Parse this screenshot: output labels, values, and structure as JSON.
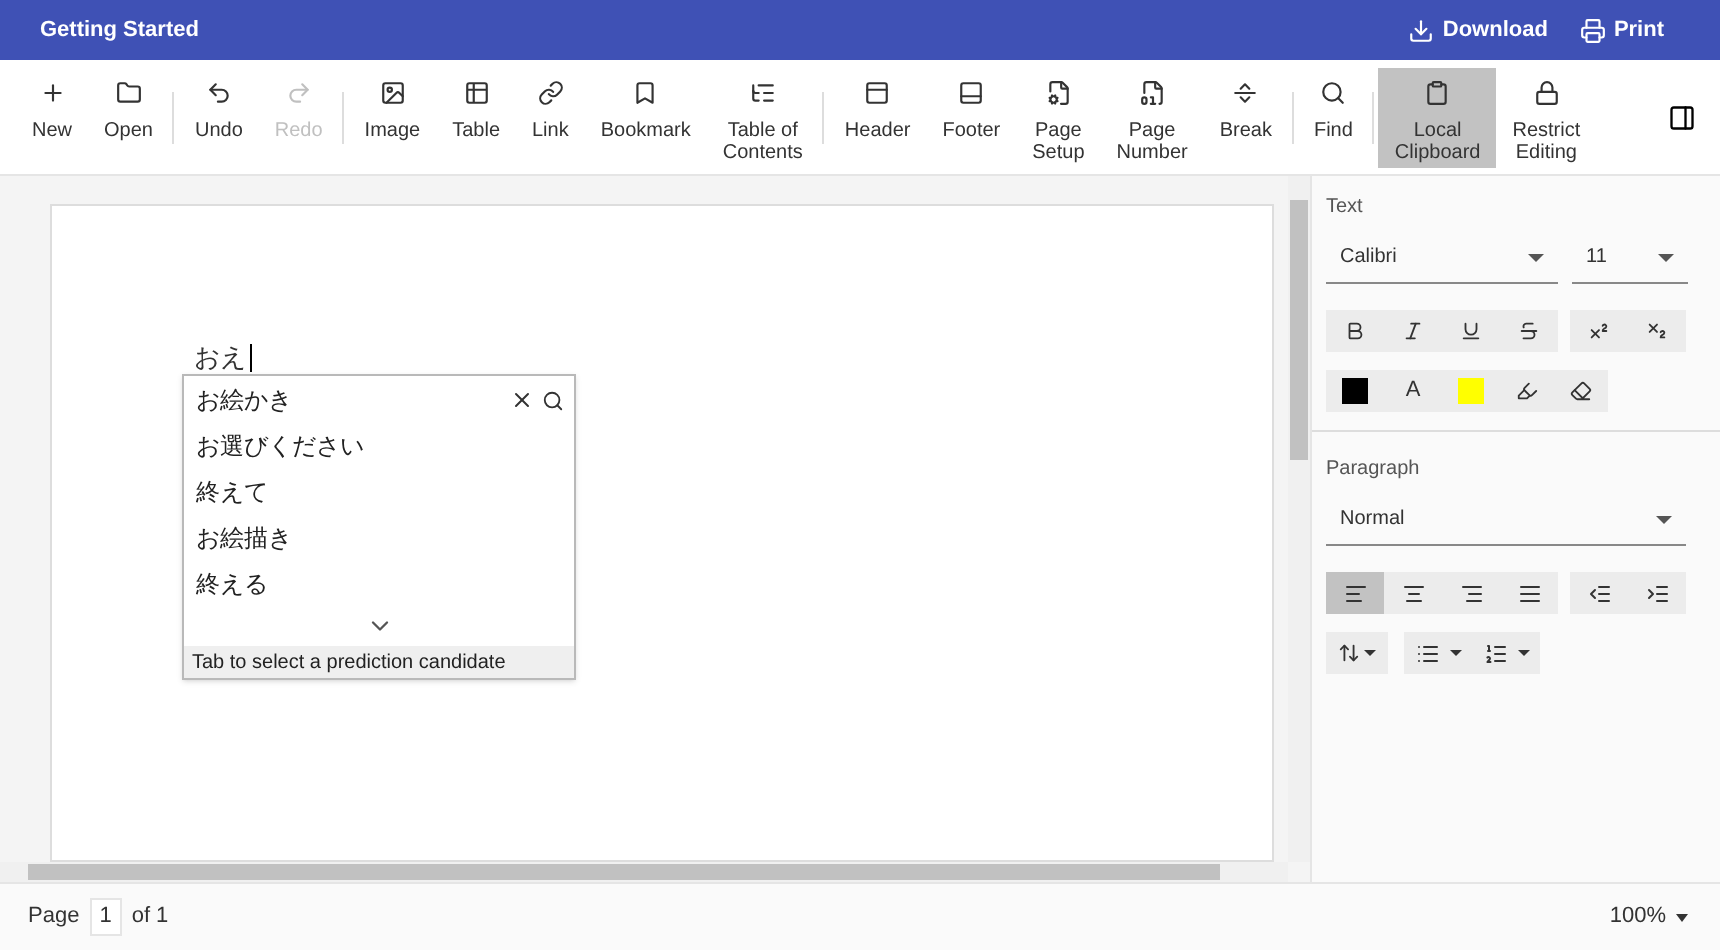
{
  "title_bar": {
    "title": "Getting Started",
    "actions": [
      {
        "label": "Download",
        "kind": "download"
      },
      {
        "label": "Print",
        "kind": "print"
      }
    ]
  },
  "toolbar": {
    "groups": [
      [
        {
          "label": "New",
          "kind": "plus",
          "disabled": false,
          "selected": false
        },
        {
          "label": "Open",
          "kind": "folder",
          "disabled": false,
          "selected": false
        }
      ],
      [
        {
          "label": "Undo",
          "kind": "undo",
          "disabled": false,
          "selected": false
        },
        {
          "label": "Redo",
          "kind": "redo",
          "disabled": true,
          "selected": false
        }
      ],
      [
        {
          "label": "Image",
          "kind": "image",
          "disabled": false,
          "selected": false
        },
        {
          "label": "Table",
          "kind": "table",
          "disabled": false,
          "selected": false
        },
        {
          "label": "Link",
          "kind": "link",
          "disabled": false,
          "selected": false
        },
        {
          "label": "Bookmark",
          "kind": "bookmark",
          "disabled": false,
          "selected": false
        },
        {
          "label": "Table of\nContents",
          "kind": "toc",
          "disabled": false,
          "selected": false
        }
      ],
      [
        {
          "label": "Header",
          "kind": "header",
          "disabled": false,
          "selected": false
        },
        {
          "label": "Footer",
          "kind": "footer",
          "disabled": false,
          "selected": false
        },
        {
          "label": "Page\nSetup",
          "kind": "pagesetup",
          "disabled": false,
          "selected": false
        },
        {
          "label": "Page\nNumber",
          "kind": "pagenumber",
          "disabled": false,
          "selected": false
        },
        {
          "label": "Break",
          "kind": "break",
          "disabled": false,
          "selected": false
        }
      ],
      [
        {
          "label": "Find",
          "kind": "search",
          "disabled": false,
          "selected": false
        }
      ],
      [
        {
          "label": "Local\nClipboard",
          "kind": "clipboard",
          "disabled": false,
          "selected": true
        },
        {
          "label": "Restrict\nEditing",
          "kind": "lock",
          "disabled": false,
          "selected": false
        }
      ]
    ]
  },
  "document": {
    "typed_text": "おえ",
    "prediction": {
      "candidates": [
        "お絵かき",
        "お選びください",
        "終えて",
        "お絵描き",
        "終える"
      ],
      "hint": "Tab to select a prediction candidate"
    }
  },
  "properties": {
    "text": {
      "heading": "Text",
      "font": "Calibri",
      "size": "11",
      "format_buttons": [
        {
          "kind": "bold"
        },
        {
          "kind": "italic"
        },
        {
          "kind": "underline"
        },
        {
          "kind": "strike"
        }
      ],
      "script_buttons": [
        {
          "kind": "superscript"
        },
        {
          "kind": "subscript"
        }
      ],
      "color_buttons": [
        {
          "kind": "swatch",
          "color": "#000000"
        },
        {
          "kind": "letter",
          "label": "A"
        },
        {
          "kind": "swatch",
          "color": "#ffff00"
        },
        {
          "kind": "highlighter"
        },
        {
          "kind": "eraser"
        }
      ]
    },
    "paragraph": {
      "heading": "Paragraph",
      "style": "Normal",
      "alignment": [
        {
          "kind": "left",
          "selected": true
        },
        {
          "kind": "center",
          "selected": false
        },
        {
          "kind": "right",
          "selected": false
        },
        {
          "kind": "justify",
          "selected": false
        }
      ],
      "indent": [
        {
          "kind": "outdent"
        },
        {
          "kind": "indent"
        }
      ]
    }
  },
  "status_bar": {
    "page_label": "Page",
    "page": "1",
    "of_label": "of 1",
    "zoom": "100%"
  }
}
